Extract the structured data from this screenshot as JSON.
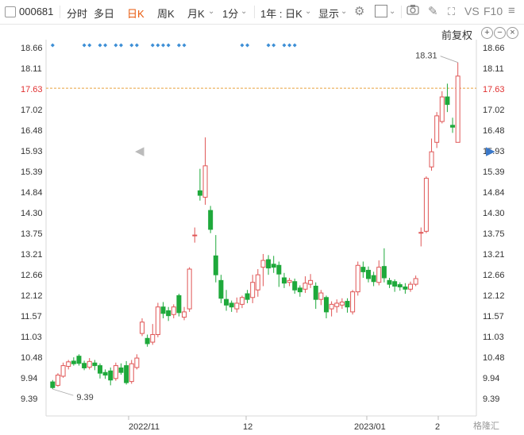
{
  "toolbar": {
    "stock_code": "000681",
    "periods": [
      "分时",
      "多日",
      "日K",
      "周K",
      "月K",
      "1分"
    ],
    "active_period": "日K",
    "range_select": "1年 : 日K",
    "display_label": "显示",
    "vs_label": "VS",
    "f10_label": "F10"
  },
  "fuquan_label": "前复权",
  "y_axis": {
    "ticks": [
      "18.66",
      "18.11",
      "17.63",
      "17.02",
      "16.48",
      "15.93",
      "15.39",
      "14.84",
      "14.30",
      "13.75",
      "13.21",
      "12.66",
      "12.12",
      "11.57",
      "11.03",
      "10.48",
      "9.94",
      "9.39"
    ],
    "current_price": "17.63",
    "current_price_color": "#e03030"
  },
  "x_axis": {
    "ticks": [
      "2022/11",
      "12",
      "2023/01",
      "2"
    ]
  },
  "annotations": {
    "high_label": "18.31",
    "low_label": "9.39"
  },
  "colors": {
    "up": "#e05656",
    "down": "#1ea93b",
    "marker": "#3d8fd6",
    "active": "#e8590c"
  },
  "watermark": "格隆汇",
  "chart_data": {
    "type": "candlestick",
    "ylim": [
      9.39,
      18.66
    ],
    "reference_price": 17.63,
    "candles": [
      {
        "o": 9.87,
        "c": 9.72,
        "h": 9.92,
        "l": 9.68
      },
      {
        "o": 9.78,
        "c": 10.05,
        "h": 10.1,
        "l": 9.74
      },
      {
        "o": 10.02,
        "c": 10.3,
        "h": 10.38,
        "l": 9.98
      },
      {
        "o": 10.28,
        "c": 10.4,
        "h": 10.45,
        "l": 10.2
      },
      {
        "o": 10.42,
        "c": 10.35,
        "h": 10.52,
        "l": 10.3
      },
      {
        "o": 10.55,
        "c": 10.36,
        "h": 10.6,
        "l": 10.3
      },
      {
        "o": 10.36,
        "c": 10.24,
        "h": 10.43,
        "l": 10.18
      },
      {
        "o": 10.26,
        "c": 10.41,
        "h": 10.5,
        "l": 10.2
      },
      {
        "o": 10.37,
        "c": 10.3,
        "h": 10.45,
        "l": 10.18
      },
      {
        "o": 10.3,
        "c": 10.1,
        "h": 10.36,
        "l": 9.96
      },
      {
        "o": 10.12,
        "c": 10.05,
        "h": 10.2,
        "l": 9.95
      },
      {
        "o": 10.16,
        "c": 9.92,
        "h": 10.25,
        "l": 9.78
      },
      {
        "o": 9.96,
        "c": 10.3,
        "h": 10.38,
        "l": 9.9
      },
      {
        "o": 10.24,
        "c": 10.12,
        "h": 10.36,
        "l": 10.06
      },
      {
        "o": 10.3,
        "c": 9.85,
        "h": 10.42,
        "l": 9.8
      },
      {
        "o": 9.88,
        "c": 10.35,
        "h": 10.45,
        "l": 9.82
      },
      {
        "o": 10.25,
        "c": 10.5,
        "h": 10.6,
        "l": 10.2
      },
      {
        "o": 11.15,
        "c": 11.45,
        "h": 11.55,
        "l": 11.08
      },
      {
        "o": 11.02,
        "c": 10.88,
        "h": 11.12,
        "l": 10.8
      },
      {
        "o": 10.92,
        "c": 11.12,
        "h": 11.4,
        "l": 10.85
      },
      {
        "o": 11.12,
        "c": 11.85,
        "h": 11.96,
        "l": 11.05
      },
      {
        "o": 11.85,
        "c": 11.68,
        "h": 11.98,
        "l": 11.55
      },
      {
        "o": 11.75,
        "c": 11.62,
        "h": 11.85,
        "l": 11.48
      },
      {
        "o": 11.65,
        "c": 11.85,
        "h": 11.92,
        "l": 11.55
      },
      {
        "o": 12.15,
        "c": 11.7,
        "h": 12.2,
        "l": 11.6
      },
      {
        "o": 11.58,
        "c": 11.72,
        "h": 11.85,
        "l": 11.5
      },
      {
        "o": 11.8,
        "c": 12.85,
        "h": 12.9,
        "l": 11.72
      },
      {
        "o": 13.75,
        "c": 13.75,
        "h": 13.95,
        "l": 13.55
      },
      {
        "o": 14.92,
        "c": 14.8,
        "h": 15.5,
        "l": 14.66
      },
      {
        "o": 14.75,
        "c": 15.58,
        "h": 16.33,
        "l": 14.55
      },
      {
        "o": 14.4,
        "c": 13.9,
        "h": 14.52,
        "l": 13.8
      },
      {
        "o": 13.2,
        "c": 12.7,
        "h": 13.75,
        "l": 12.5
      },
      {
        "o": 12.55,
        "c": 12.08,
        "h": 12.7,
        "l": 11.95
      },
      {
        "o": 12.05,
        "c": 11.9,
        "h": 12.3,
        "l": 11.75
      },
      {
        "o": 11.95,
        "c": 11.85,
        "h": 12.02,
        "l": 11.72
      },
      {
        "o": 11.8,
        "c": 11.95,
        "h": 12.1,
        "l": 11.7
      },
      {
        "o": 11.92,
        "c": 12.1,
        "h": 12.15,
        "l": 11.82
      },
      {
        "o": 12.2,
        "c": 12.05,
        "h": 12.3,
        "l": 11.95
      },
      {
        "o": 12.1,
        "c": 12.5,
        "h": 12.7,
        "l": 11.95
      },
      {
        "o": 12.3,
        "c": 12.7,
        "h": 12.85,
        "l": 12.12
      },
      {
        "o": 12.9,
        "c": 13.08,
        "h": 13.25,
        "l": 12.4
      },
      {
        "o": 13.1,
        "c": 12.88,
        "h": 13.22,
        "l": 12.7
      },
      {
        "o": 12.98,
        "c": 12.9,
        "h": 13.2,
        "l": 12.75
      },
      {
        "o": 12.95,
        "c": 12.72,
        "h": 13.05,
        "l": 12.38
      },
      {
        "o": 12.62,
        "c": 12.48,
        "h": 12.75,
        "l": 12.35
      },
      {
        "o": 12.5,
        "c": 12.55,
        "h": 12.62,
        "l": 12.4
      },
      {
        "o": 12.52,
        "c": 12.3,
        "h": 12.6,
        "l": 12.2
      },
      {
        "o": 12.35,
        "c": 12.25,
        "h": 12.42,
        "l": 12.12
      },
      {
        "o": 12.32,
        "c": 12.48,
        "h": 12.66,
        "l": 12.22
      },
      {
        "o": 12.45,
        "c": 12.55,
        "h": 12.72,
        "l": 12.35
      },
      {
        "o": 12.4,
        "c": 12.05,
        "h": 12.5,
        "l": 11.8
      },
      {
        "o": 12.05,
        "c": 12.22,
        "h": 12.3,
        "l": 11.9
      },
      {
        "o": 12.1,
        "c": 11.72,
        "h": 12.15,
        "l": 11.55
      },
      {
        "o": 11.8,
        "c": 11.92,
        "h": 12.0,
        "l": 11.6
      },
      {
        "o": 11.86,
        "c": 11.95,
        "h": 12.05,
        "l": 11.7
      },
      {
        "o": 11.9,
        "c": 11.98,
        "h": 12.08,
        "l": 11.8
      },
      {
        "o": 12.0,
        "c": 11.85,
        "h": 12.08,
        "l": 11.7
      },
      {
        "o": 11.72,
        "c": 12.25,
        "h": 12.3,
        "l": 11.65
      },
      {
        "o": 12.25,
        "c": 12.95,
        "h": 13.05,
        "l": 12.15
      },
      {
        "o": 12.9,
        "c": 12.78,
        "h": 13.05,
        "l": 12.62
      },
      {
        "o": 12.82,
        "c": 12.6,
        "h": 12.92,
        "l": 12.5
      },
      {
        "o": 12.68,
        "c": 12.52,
        "h": 12.78,
        "l": 12.4
      },
      {
        "o": 12.5,
        "c": 12.9,
        "h": 13.08,
        "l": 12.42
      },
      {
        "o": 12.92,
        "c": 12.62,
        "h": 13.4,
        "l": 12.5
      },
      {
        "o": 12.55,
        "c": 12.45,
        "h": 12.62,
        "l": 12.35
      },
      {
        "o": 12.52,
        "c": 12.4,
        "h": 12.58,
        "l": 12.25
      },
      {
        "o": 12.44,
        "c": 12.38,
        "h": 12.5,
        "l": 12.28
      },
      {
        "o": 12.38,
        "c": 12.32,
        "h": 12.48,
        "l": 12.2
      },
      {
        "o": 12.32,
        "c": 12.45,
        "h": 12.52,
        "l": 12.25
      },
      {
        "o": 12.45,
        "c": 12.6,
        "h": 12.68,
        "l": 12.4
      },
      {
        "o": 13.8,
        "c": 13.82,
        "h": 13.95,
        "l": 13.45
      },
      {
        "o": 13.85,
        "c": 15.25,
        "h": 15.3,
        "l": 13.8
      },
      {
        "o": 15.55,
        "c": 15.95,
        "h": 16.3,
        "l": 15.45
      },
      {
        "o": 16.2,
        "c": 16.9,
        "h": 17.0,
        "l": 16.05
      },
      {
        "o": 16.75,
        "c": 17.4,
        "h": 17.55,
        "l": 16.7
      },
      {
        "o": 17.4,
        "c": 17.2,
        "h": 17.75,
        "l": 17.0
      },
      {
        "o": 16.65,
        "c": 16.6,
        "h": 16.85,
        "l": 16.45
      },
      {
        "o": 16.2,
        "c": 17.95,
        "h": 18.31,
        "l": 16.2
      }
    ],
    "markers": [
      0,
      6,
      7,
      9,
      10,
      12,
      13,
      15,
      16,
      19,
      20,
      21,
      22,
      24,
      25,
      36,
      37,
      41,
      42,
      44,
      45,
      46
    ]
  }
}
